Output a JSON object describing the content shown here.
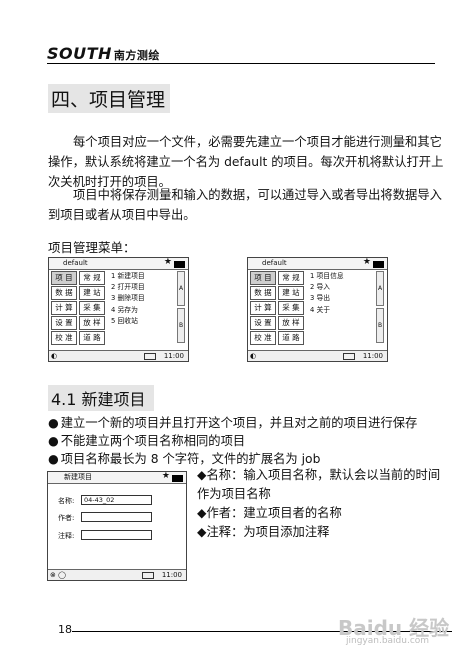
{
  "header": {
    "brand": "SOUTH",
    "brand_cn": "南方测绘"
  },
  "section": {
    "title": "四、项目管理",
    "para1": "每个项目对应一个文件，必需要先建立一个项目才能进行测量和其它操作，默认系统将建立一个名为 default 的项目。每次开机将默认打开上次关机时打开的项目。",
    "para2": "项目中将保存测量和输入的数据，可以通过导入或者导出将数据导入到项目或者从项目中导出。",
    "menu_label": "项目管理菜单："
  },
  "screen1": {
    "title": "default",
    "left_col": [
      "项 目",
      "数 据",
      "计 算",
      "设 置",
      "校 准"
    ],
    "right_col": [
      "常 规",
      "建 站",
      "采 集",
      "放 样",
      "道 路"
    ],
    "items": [
      "1  新建项目",
      "2  打开项目",
      "3  删除项目",
      "4  另存为",
      "5  回收站"
    ],
    "scroll_a": "A",
    "scroll_b": "B",
    "time": "11:00"
  },
  "screen2": {
    "title": "default",
    "left_col": [
      "项 目",
      "数 据",
      "计 算",
      "设 置",
      "校 准"
    ],
    "right_col": [
      "常 规",
      "建 站",
      "采 集",
      "放 样",
      "道 路"
    ],
    "items": [
      "1  项目信息",
      "2  导入",
      "3  导出",
      "4  关于"
    ],
    "scroll_a": "A",
    "scroll_b": "B",
    "time": "11:00"
  },
  "subsection": {
    "title": "4.1 新建项目",
    "bullets": [
      "建立一个新的项目并且打开这个项目，并且对之前的项目进行保存",
      "不能建立两个项目名称相同的项目",
      "项目名称最长为 8 个字符，文件的扩展名为 job"
    ],
    "right_bullets": [
      "名称：输入项目名称，默认会以当前的时间作为项目名称",
      "作者：建立项目者的名称",
      "注释：为项目添加注释"
    ]
  },
  "screen3": {
    "title": "新建项目",
    "name_label": "名称:",
    "name_value": "04-43_02",
    "author_label": "作者:",
    "note_label": "注释:",
    "time": "11:00"
  },
  "footer": {
    "page_number": "18"
  },
  "watermark": {
    "text": "Baidu 经验",
    "sub": "jingyan.baidu.com"
  }
}
